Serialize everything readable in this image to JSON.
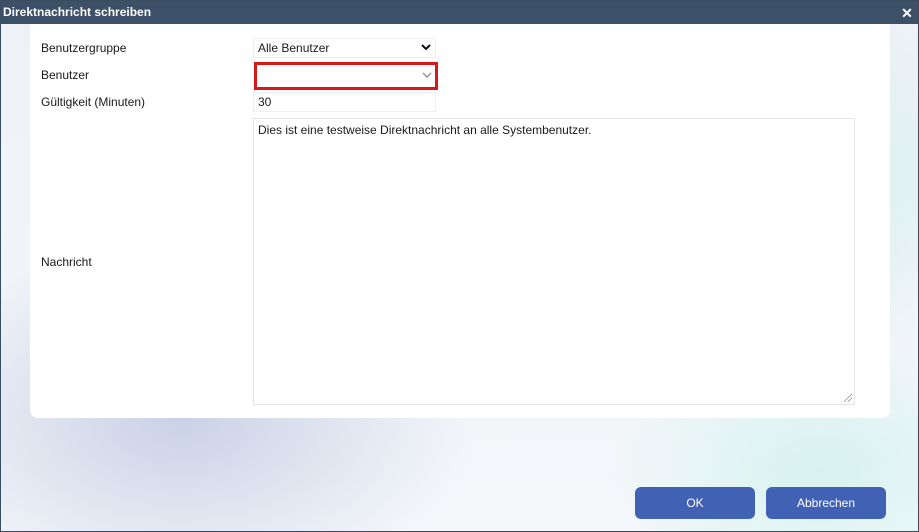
{
  "dialog": {
    "title": "Direktnachricht schreiben",
    "close_icon": "close-icon",
    "close_glyph": "✕"
  },
  "form": {
    "group_label": "Benutzergruppe",
    "group_value": "Alle Benutzer",
    "user_label": "Benutzer",
    "user_value": "",
    "validity_label": "Gültigkeit (Minuten)",
    "validity_value": "30",
    "message_label": "Nachricht",
    "message_value": "Dies ist eine testweise Direktnachricht an alle Systembenutzer."
  },
  "buttons": {
    "ok_label": "OK",
    "cancel_label": "Abbrechen"
  },
  "colors": {
    "titlebar": "#3c5068",
    "button": "#4161b4",
    "highlight": "#d81818"
  },
  "icons": {
    "dropdown": "chevron-down-icon",
    "dropdown_glyph": "⌄"
  }
}
